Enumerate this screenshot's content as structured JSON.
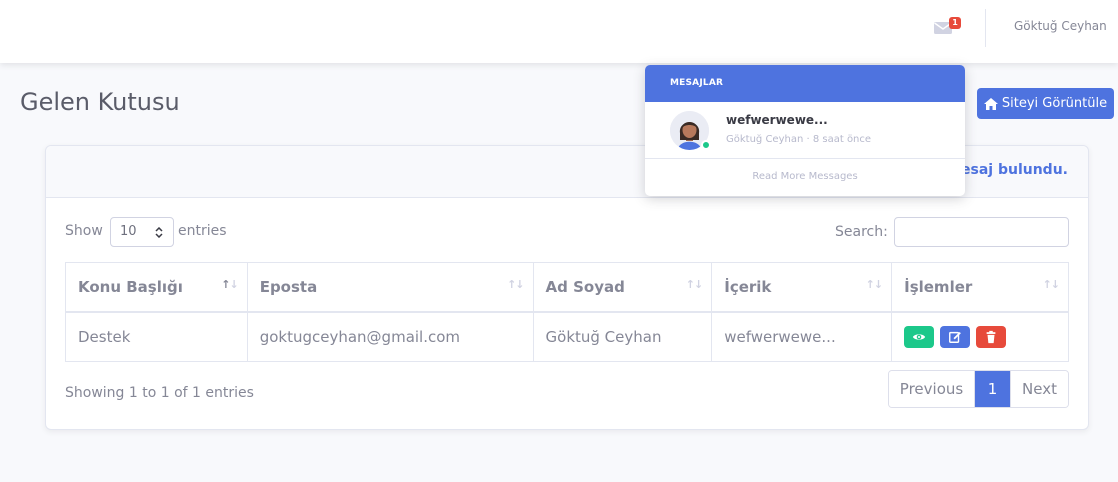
{
  "topbar": {
    "message_count": "1",
    "user_name": "Göktuğ Ceyhan"
  },
  "page": {
    "title": "Gelen Kutusu",
    "site_button": "Siteyi Görüntüle"
  },
  "card": {
    "header_text": "mesaj bulundu."
  },
  "datatable": {
    "show_label": "Show",
    "length_value": "10",
    "entries_label": "entries",
    "search_label": "Search:",
    "search_value": "",
    "columns": [
      "Konu Başlığı",
      "Eposta",
      "Ad Soyad",
      "İçerik",
      "İşlemler"
    ],
    "rows": [
      [
        "Destek",
        "goktugceyhan@gmail.com",
        "Göktuğ Ceyhan",
        "wefwerwewe..."
      ]
    ],
    "info": "Showing 1 to 1 of 1 entries",
    "pagination": {
      "previous": "Previous",
      "current": "1",
      "next": "Next"
    }
  },
  "messages_dropdown": {
    "header": "MESAJLAR",
    "items": [
      {
        "subject": "wefwerwewe...",
        "meta": "Göktuğ Ceyhan · 8 saat önce"
      }
    ],
    "footer": "Read More Messages"
  },
  "icons": {
    "envelope": "envelope-icon",
    "home": "home-icon",
    "view": "eye-icon",
    "edit": "edit-icon",
    "delete": "trash-icon"
  },
  "colors": {
    "primary": "#4e73df",
    "success": "#1cc88a",
    "danger": "#e74a3b",
    "text": "#858796"
  }
}
